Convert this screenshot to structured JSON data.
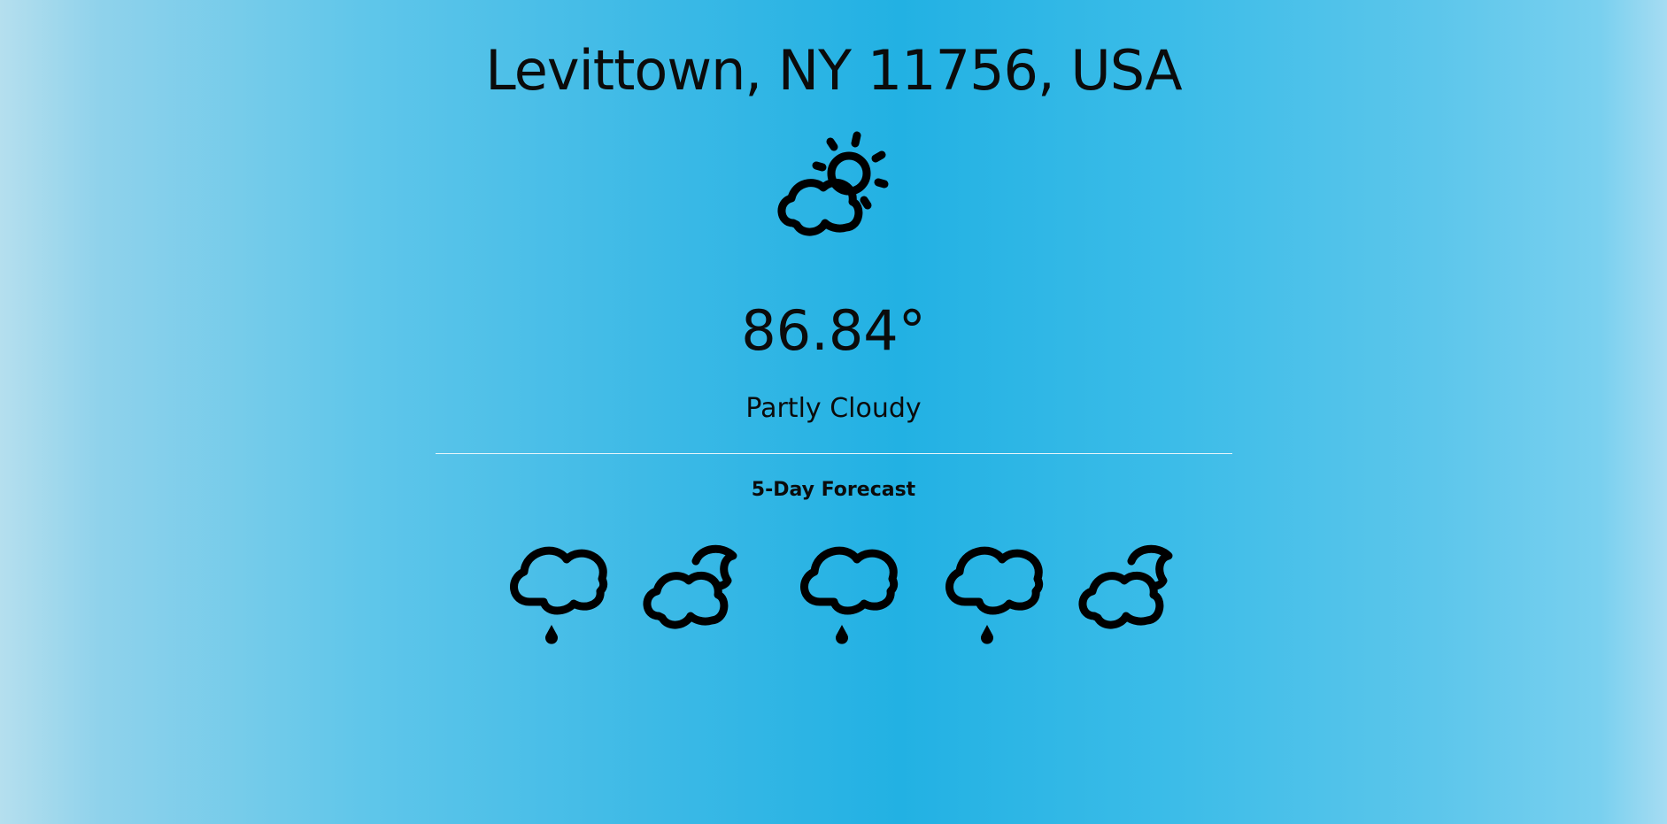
{
  "location": {
    "title": "Levittown, NY 11756, USA"
  },
  "current": {
    "icon": "partly-cloudy-day-icon",
    "temperature": "86.84°",
    "condition": "Partly Cloudy"
  },
  "forecast": {
    "title": "5-Day Forecast",
    "days": [
      {
        "icon": "rain-icon"
      },
      {
        "icon": "partly-cloudy-night-icon"
      },
      {
        "icon": "rain-icon"
      },
      {
        "icon": "rain-icon"
      },
      {
        "icon": "partly-cloudy-night-icon"
      }
    ]
  },
  "colors": {
    "background_center": "#22b1e3",
    "background_edge": "#b5dfee",
    "text": "#0b0b0b"
  }
}
